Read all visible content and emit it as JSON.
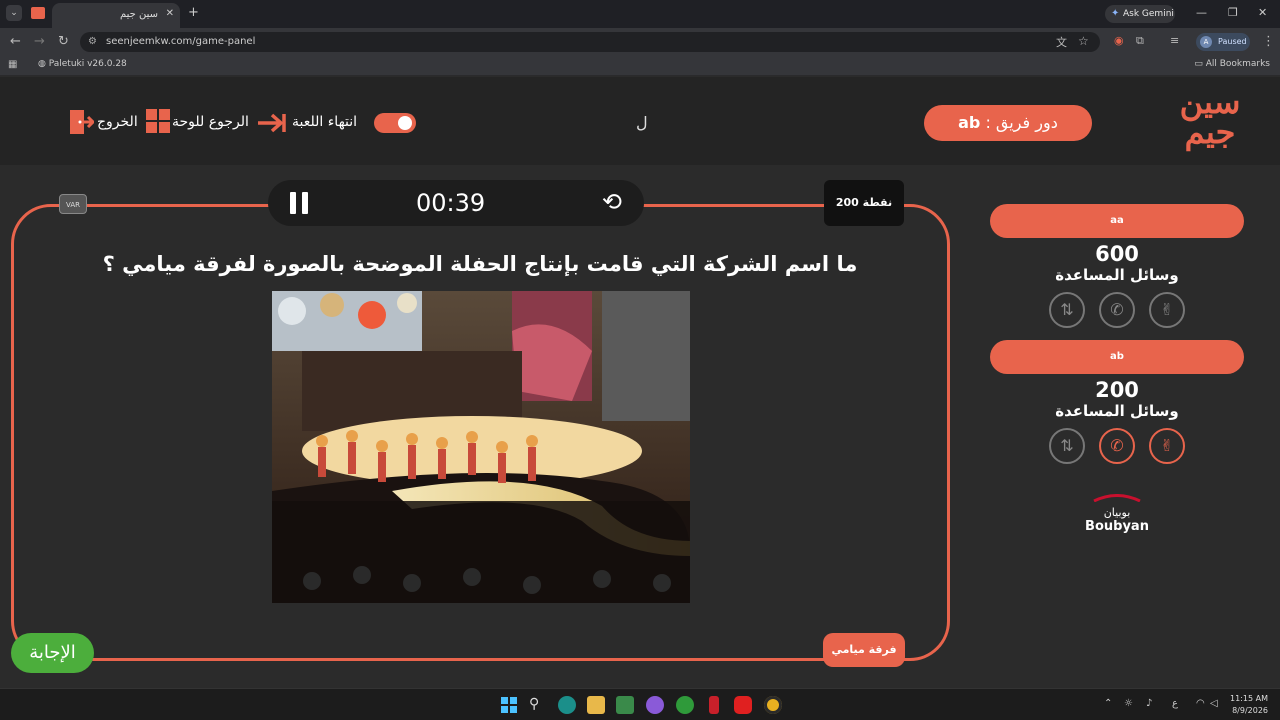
{
  "browser": {
    "tab_title": "سين جيم",
    "tab_close": "✕",
    "new_tab": "+",
    "ask_gemini": "Ask Gemini",
    "url": "seenjeemkw.com/game-panel",
    "profile_initial": "A",
    "profile_status": "Paused",
    "bookmark_item": "Paletuki v26.0.28",
    "all_bookmarks": "All Bookmarks"
  },
  "header": {
    "logo_line1": "سين",
    "logo_line2": "جيم",
    "team_turn_label": "دور فريق :",
    "team_turn_value": "ab",
    "letter": "ل",
    "end_game": "انتهاء اللعبة",
    "back_to_board": "الرجوع للوحة",
    "exit": "الخروج"
  },
  "game": {
    "timer": "00:39",
    "points": "200 نقطة",
    "var_label": "VAR",
    "question": "ما اسم الشركة التي قامت بإنتاج الحفلة الموضحة بالصورة لفرقة ميامي ؟",
    "answer_tag": "فرقة ميامي",
    "answer_button": "الإجابة"
  },
  "teams": [
    {
      "name": "aa",
      "score": "600",
      "lifelines_label": "وسائل المساعدة",
      "lifelines": [
        {
          "icon": "double-arrow-icon",
          "glyph": "⇅",
          "active": false
        },
        {
          "icon": "phone-icon",
          "glyph": "✆",
          "active": false
        },
        {
          "icon": "peace-hand-icon",
          "glyph": "✌",
          "active": false
        }
      ]
    },
    {
      "name": "ab",
      "score": "200",
      "lifelines_label": "وسائل المساعدة",
      "lifelines": [
        {
          "icon": "double-arrow-icon",
          "glyph": "⇅",
          "active": false
        },
        {
          "icon": "phone-icon",
          "glyph": "✆",
          "active": true
        },
        {
          "icon": "peace-hand-icon",
          "glyph": "✌",
          "active": true
        }
      ]
    }
  ],
  "sponsor": {
    "arabic": "بوبيان",
    "english": "Boubyan"
  },
  "taskbar": {
    "time": "11:15 AM",
    "date": "8/9/2026",
    "lang": "ع"
  },
  "colors": {
    "accent": "#e8644c",
    "answer_green": "#4cae3c",
    "background": "#2b2b2b"
  }
}
